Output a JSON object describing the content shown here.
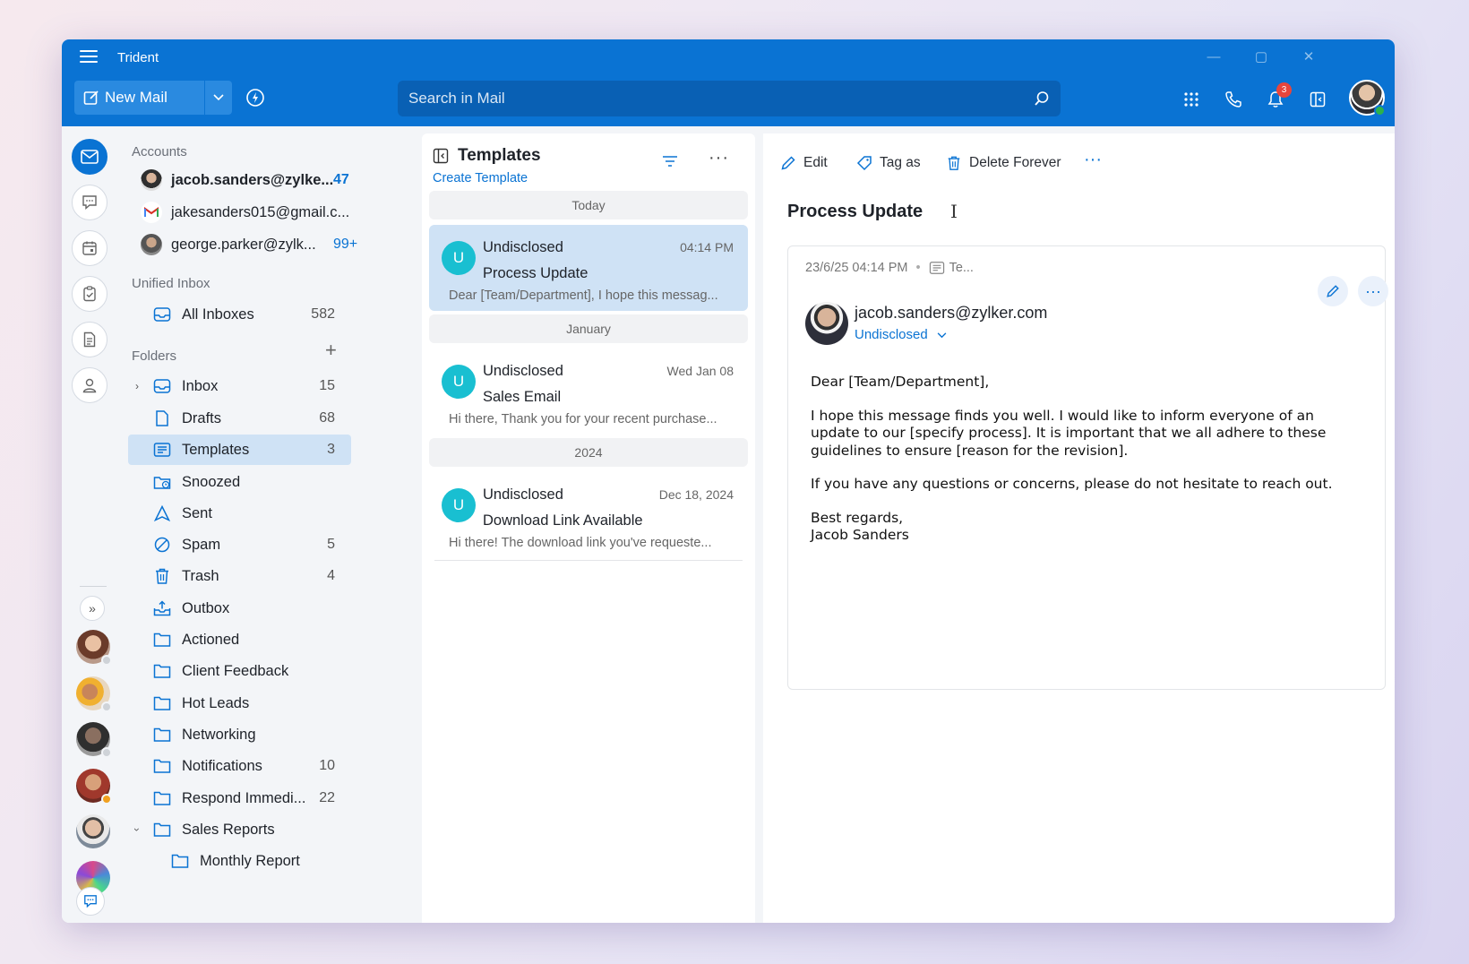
{
  "app": {
    "title": "Trident"
  },
  "header": {
    "new_mail_label": "New Mail",
    "search_placeholder": "Search in Mail",
    "notification_count": "3"
  },
  "accounts": {
    "section_label": "Accounts",
    "items": [
      {
        "email": "jacob.sanders@zylke...",
        "count": "47"
      },
      {
        "email": "jakesanders015@gmail.c...",
        "count": ""
      },
      {
        "email": "george.parker@zylk...",
        "count": "99+"
      }
    ]
  },
  "unified": {
    "section_label": "Unified Inbox",
    "all_inboxes": "All Inboxes",
    "all_count": "582"
  },
  "folders": {
    "section_label": "Folders",
    "items": [
      {
        "label": "Inbox",
        "count": "15"
      },
      {
        "label": "Drafts",
        "count": "68"
      },
      {
        "label": "Templates",
        "count": "3"
      },
      {
        "label": "Snoozed",
        "count": ""
      },
      {
        "label": "Sent",
        "count": ""
      },
      {
        "label": "Spam",
        "count": "5"
      },
      {
        "label": "Trash",
        "count": "4"
      },
      {
        "label": "Outbox",
        "count": ""
      },
      {
        "label": "Actioned",
        "count": ""
      },
      {
        "label": "Client Feedback",
        "count": ""
      },
      {
        "label": "Hot Leads",
        "count": ""
      },
      {
        "label": "Networking",
        "count": ""
      },
      {
        "label": "Notifications",
        "count": "10"
      },
      {
        "label": "Respond Immedi...",
        "count": "22"
      },
      {
        "label": "Sales Reports",
        "count": ""
      },
      {
        "label": "Monthly Report",
        "count": ""
      }
    ]
  },
  "list": {
    "title": "Templates",
    "create_label": "Create Template",
    "groups": [
      "Today",
      "January",
      "2024"
    ],
    "messages": [
      {
        "initial": "U",
        "from": "Undisclosed",
        "time": "04:14 PM",
        "subject": "Process Update",
        "preview": "Dear [Team/Department], I hope this messag..."
      },
      {
        "initial": "U",
        "from": "Undisclosed",
        "time": "Wed Jan 08",
        "subject": "Sales Email",
        "preview": "Hi there, Thank you for your recent purchase..."
      },
      {
        "initial": "U",
        "from": "Undisclosed",
        "time": "Dec 18, 2024",
        "subject": "Download Link Available",
        "preview": "Hi there! The download link you've requeste..."
      }
    ]
  },
  "reading": {
    "toolbar": {
      "edit": "Edit",
      "tag": "Tag as",
      "delete": "Delete Forever"
    },
    "subject": "Process Update",
    "date": "23/6/25 04:14 PM",
    "folder_short": "Te...",
    "sender": "jacob.sanders@zylker.com",
    "recipient": "Undisclosed",
    "body": {
      "greeting": "Dear [Team/Department],",
      "p1_l1": "I hope this message finds you well. I would like to inform everyone of an",
      "p1_l2": "update to our [specify process]. It is important that we all adhere to these",
      "p1_l3": "guidelines to ensure [reason for the revision].",
      "p2": "If you have any questions or concerns, please do not hesitate to reach out.",
      "sign1": "Best regards,",
      "sign2": "Jacob Sanders"
    }
  },
  "colors": {
    "accent": "#0a73d3",
    "selection": "#cfe2f5",
    "avatar_teal": "#19bfd1",
    "badge_red": "#e8453c",
    "online_green": "#2bb24c"
  }
}
